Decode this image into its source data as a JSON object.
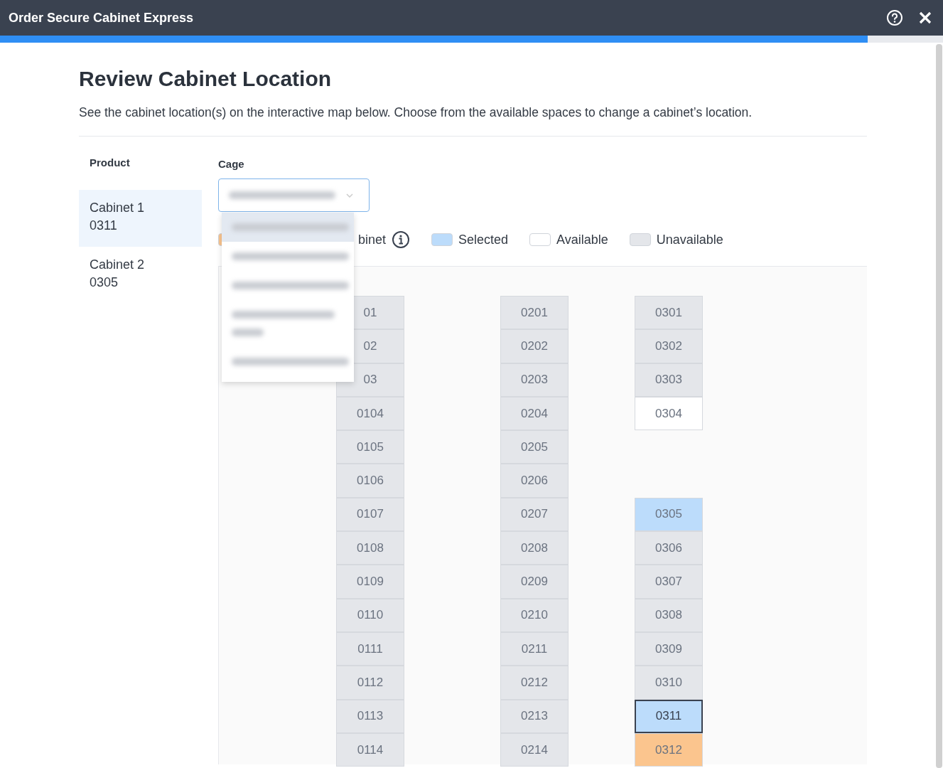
{
  "window": {
    "title": "Order Secure Cabinet Express"
  },
  "progress": {
    "level": 0.92
  },
  "heading": "Review Cabinet Location",
  "description": "See the cabinet location(s) on the interactive map below. Choose from the available spaces to change a cabinet’s location.",
  "products": {
    "label": "Product",
    "items": [
      {
        "name": "Cabinet 1",
        "space": "0311",
        "selected": true
      },
      {
        "name": "Cabinet 2",
        "space": "0305",
        "selected": false
      }
    ]
  },
  "cage": {
    "label": "Cage",
    "expanded": true,
    "options": [
      {
        "kind": "single",
        "selected": true
      },
      {
        "kind": "single",
        "selected": false
      },
      {
        "kind": "single",
        "selected": false
      },
      {
        "kind": "double",
        "selected": false
      },
      {
        "kind": "single",
        "selected": false
      }
    ]
  },
  "legend": [
    {
      "kind": "current",
      "label": "binet",
      "info": true
    },
    {
      "kind": "selected",
      "label": "Selected",
      "info": false
    },
    {
      "kind": "available",
      "label": "Available",
      "info": false
    },
    {
      "kind": "unavailable",
      "label": "Unavailable",
      "info": false
    }
  ],
  "map": {
    "columns": [
      {
        "cells": [
          {
            "label": "01",
            "kind": "unavailable",
            "active": false
          },
          {
            "label": "02",
            "kind": "unavailable",
            "active": false
          },
          {
            "label": "03",
            "kind": "unavailable",
            "active": false
          },
          {
            "label": "0104",
            "kind": "unavailable",
            "active": false
          },
          {
            "label": "0105",
            "kind": "unavailable",
            "active": false
          },
          {
            "label": "0106",
            "kind": "unavailable",
            "active": false
          },
          {
            "label": "0107",
            "kind": "unavailable",
            "active": false
          },
          {
            "label": "0108",
            "kind": "unavailable",
            "active": false
          },
          {
            "label": "0109",
            "kind": "unavailable",
            "active": false
          },
          {
            "label": "0110",
            "kind": "unavailable",
            "active": false
          },
          {
            "label": "0111",
            "kind": "unavailable",
            "active": false
          },
          {
            "label": "0112",
            "kind": "unavailable",
            "active": false
          },
          {
            "label": "0113",
            "kind": "unavailable",
            "active": false
          },
          {
            "label": "0114",
            "kind": "unavailable",
            "active": false
          }
        ]
      },
      {
        "cells": [
          {
            "label": "0201",
            "kind": "unavailable",
            "active": false
          },
          {
            "label": "0202",
            "kind": "unavailable",
            "active": false
          },
          {
            "label": "0203",
            "kind": "unavailable",
            "active": false
          },
          {
            "label": "0204",
            "kind": "unavailable",
            "active": false
          },
          {
            "label": "0205",
            "kind": "unavailable",
            "active": false
          },
          {
            "label": "0206",
            "kind": "unavailable",
            "active": false
          },
          {
            "label": "0207",
            "kind": "unavailable",
            "active": false
          },
          {
            "label": "0208",
            "kind": "unavailable",
            "active": false
          },
          {
            "label": "0209",
            "kind": "unavailable",
            "active": false
          },
          {
            "label": "0210",
            "kind": "unavailable",
            "active": false
          },
          {
            "label": "0211",
            "kind": "unavailable",
            "active": false
          },
          {
            "label": "0212",
            "kind": "unavailable",
            "active": false
          },
          {
            "label": "0213",
            "kind": "unavailable",
            "active": false
          },
          {
            "label": "0214",
            "kind": "unavailable",
            "active": false
          }
        ]
      },
      {
        "cells": [
          {
            "label": "0301",
            "kind": "unavailable",
            "active": false
          },
          {
            "label": "0302",
            "kind": "unavailable",
            "active": false
          },
          {
            "label": "0303",
            "kind": "unavailable",
            "active": false
          },
          {
            "label": "0304",
            "kind": "available",
            "active": false
          },
          {
            "kind": "empty"
          },
          {
            "kind": "empty"
          },
          {
            "label": "0305",
            "kind": "selected",
            "active": false
          },
          {
            "label": "0306",
            "kind": "unavailable",
            "active": false
          },
          {
            "label": "0307",
            "kind": "unavailable",
            "active": false
          },
          {
            "label": "0308",
            "kind": "unavailable",
            "active": false
          },
          {
            "label": "0309",
            "kind": "unavailable",
            "active": false
          },
          {
            "label": "0310",
            "kind": "unavailable",
            "active": false
          },
          {
            "label": "0311",
            "kind": "selected",
            "active": true
          },
          {
            "label": "0312",
            "kind": "current",
            "active": false
          }
        ]
      }
    ]
  }
}
